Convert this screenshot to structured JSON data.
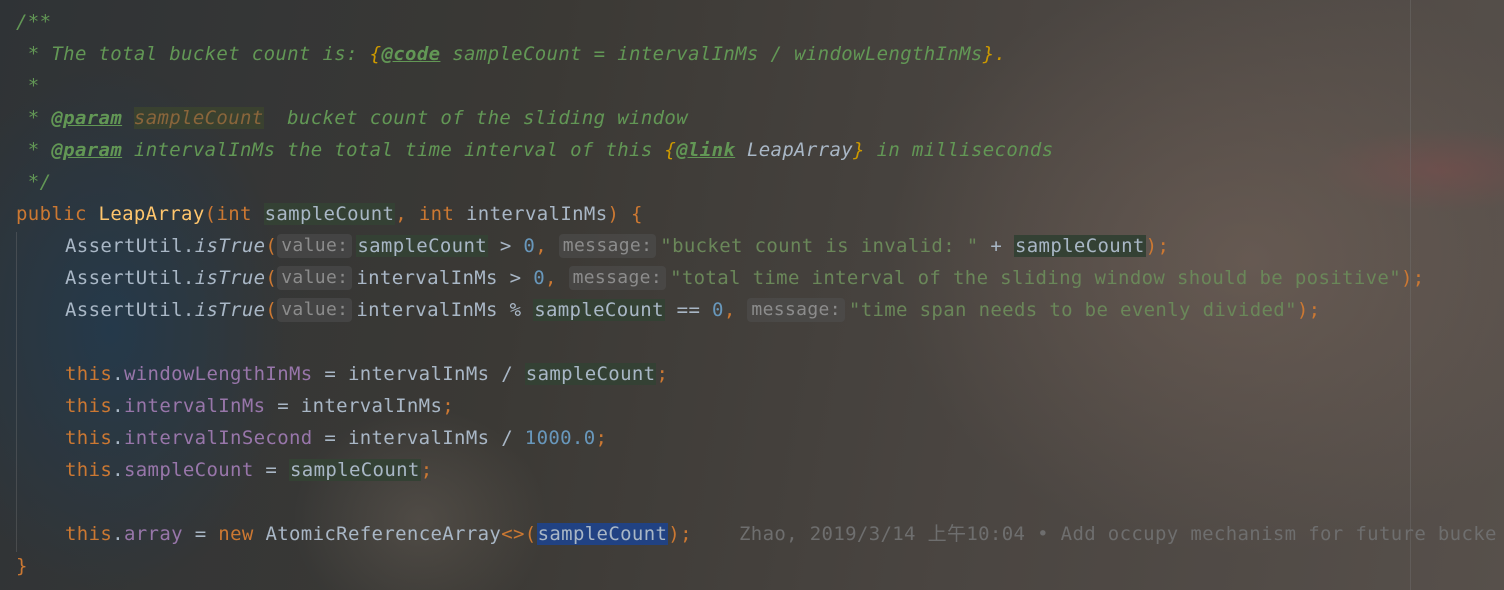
{
  "doc": {
    "open": "/**",
    "line1": {
      "prefix": " * The total bucket count is: ",
      "brace_open": "{",
      "tag": "@code",
      "code": " sampleCount = intervalInMs / windowLengthInMs",
      "brace_close": "}",
      "suffix": "."
    },
    "line2": " *",
    "line3": {
      "star": " * ",
      "tag": "@param",
      "space": " ",
      "name": "sampleCount",
      "desc": "  bucket count of the sliding window"
    },
    "line4": {
      "star": " * ",
      "tag": "@param",
      "space": " ",
      "name": "intervalInMs",
      "desc": " the total time interval of this ",
      "brace_open": "{",
      "link_tag": "@link",
      "link_target": " LeapArray",
      "brace_close": "}",
      "desc2": " in milliseconds"
    },
    "close": " */"
  },
  "signature": {
    "kw_public": "public ",
    "name": "LeapArray",
    "paren_open": "(",
    "kw_int1": "int ",
    "param1": "sampleCount",
    "comma": ", ",
    "kw_int2": "int ",
    "param2": "intervalInMs",
    "paren_close": ") {"
  },
  "assert1": {
    "cls": "AssertUtil.",
    "method": "isTrue",
    "open": "(",
    "hint_value": "value:",
    "arg1": "sampleCount",
    "op": " > ",
    "num": "0",
    "comma": ", ",
    "hint_message": "message:",
    "str": "\"bucket count is invalid: \"",
    "plus": " + ",
    "arg2": "sampleCount",
    "close": ");"
  },
  "assert2": {
    "cls": "AssertUtil.",
    "method": "isTrue",
    "open": "(",
    "hint_value": "value:",
    "arg1": "intervalInMs",
    "op": " > ",
    "num": "0",
    "comma": ", ",
    "hint_message": "message:",
    "str": "\"total time interval of the sliding window should be positive\"",
    "close": ");"
  },
  "assert3": {
    "cls": "AssertUtil.",
    "method": "isTrue",
    "open": "(",
    "hint_value": "value:",
    "arg1": "intervalInMs",
    "op": " % ",
    "arg2": "sampleCount",
    "op2": " == ",
    "num": "0",
    "comma": ", ",
    "hint_message": "message:",
    "str": "\"time span needs to be evenly divided\"",
    "close": ");"
  },
  "assign1": {
    "this": "this",
    "dot": ".",
    "field": "windowLengthInMs",
    "eq": " = intervalInMs / ",
    "rhs": "sampleCount",
    "semi": ";"
  },
  "assign2": {
    "this": "this",
    "dot": ".",
    "field": "intervalInMs",
    "eq": " = intervalInMs",
    "semi": ";"
  },
  "assign3": {
    "this": "this",
    "dot": ".",
    "field": "intervalInSecond",
    "eq": " = intervalInMs / ",
    "num": "1000.0",
    "semi": ";"
  },
  "assign4": {
    "this": "this",
    "dot": ".",
    "field": "sampleCount",
    "eq": " = ",
    "rhs": "sampleCount",
    "semi": ";"
  },
  "assign5": {
    "this": "this",
    "dot": ".",
    "field": "array",
    "eq": " = ",
    "kw_new": "new ",
    "cls": "AtomicReferenceArray",
    "diamond": "<>(",
    "arg": "sampleCount",
    "close": ");",
    "blame": "    Zhao, 2019/3/14 上午10:04 • Add occupy mechanism for future bucke"
  },
  "closing_brace": "}"
}
